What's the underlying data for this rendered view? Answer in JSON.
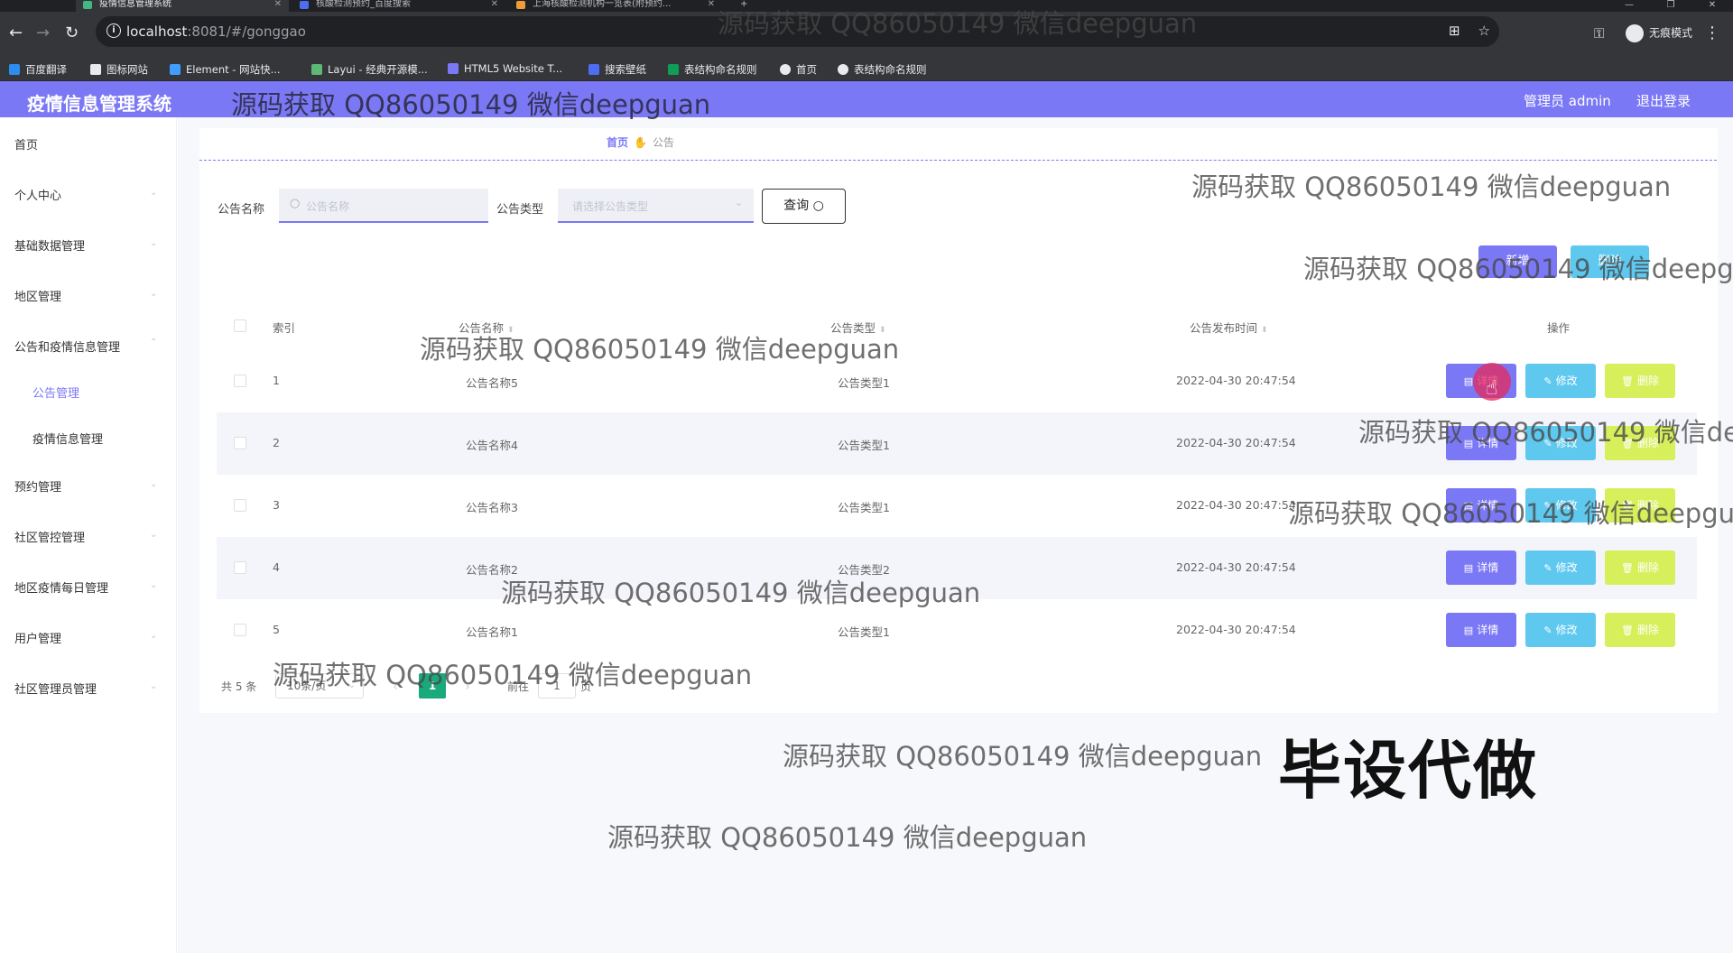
{
  "browser": {
    "tabs": [
      {
        "label": "疫情信息管理系统",
        "active": true
      },
      {
        "label": "核酸检测预约_百度搜索",
        "active": false
      },
      {
        "label": "上海核酸检测机构一览表(附预约...",
        "active": false
      }
    ],
    "new_tab": "+",
    "url_host": "localhost",
    "url_rest": ":8081/#/gonggao",
    "incognito_label": "无痕模式",
    "bookmarks": [
      "百度翻译",
      "图标网站",
      "Element - 网站快...",
      "Layui - 经典开源模...",
      "HTML5 Website T...",
      "搜索壁纸",
      "表结构命名规则",
      "首页",
      "表结构命名规则"
    ]
  },
  "header": {
    "title": "疫情信息管理系统",
    "admin_label": "管理员 admin",
    "logout": "退出登录"
  },
  "sidebar": {
    "items": [
      {
        "label": "首页",
        "arrow": false
      },
      {
        "label": "个人中心",
        "arrow": true
      },
      {
        "label": "基础数据管理",
        "arrow": true
      },
      {
        "label": "地区管理",
        "arrow": true
      },
      {
        "label": "公告和疫情信息管理",
        "arrow": true
      },
      {
        "label": "公告管理",
        "sub": true,
        "active": true
      },
      {
        "label": "疫情信息管理",
        "sub": true
      },
      {
        "label": "预约管理",
        "arrow": true
      },
      {
        "label": "社区管控管理",
        "arrow": true
      },
      {
        "label": "地区疫情每日管理",
        "arrow": true
      },
      {
        "label": "用户管理",
        "arrow": true
      },
      {
        "label": "社区管理员管理",
        "arrow": true
      }
    ]
  },
  "breadcrumb": {
    "home": "首页",
    "current": "公告"
  },
  "search": {
    "name_label": "公告名称",
    "name_placeholder": "公告名称",
    "type_label": "公告类型",
    "type_placeholder": "请选择公告类型",
    "query_button": "查询"
  },
  "toolbar": {
    "add": "新增",
    "batch_delete": "删除"
  },
  "table": {
    "headers": {
      "index": "索引",
      "name": "公告名称",
      "type": "公告类型",
      "time": "公告发布时间",
      "actions": "操作"
    },
    "rows": [
      {
        "index": "1",
        "name": "公告名称5",
        "type": "公告类型1",
        "time": "2022-04-30 20:47:54"
      },
      {
        "index": "2",
        "name": "公告名称4",
        "type": "公告类型1",
        "time": "2022-04-30 20:47:54"
      },
      {
        "index": "3",
        "name": "公告名称3",
        "type": "公告类型1",
        "time": "2022-04-30 20:47:54"
      },
      {
        "index": "4",
        "name": "公告名称2",
        "type": "公告类型2",
        "time": "2022-04-30 20:47:54"
      },
      {
        "index": "5",
        "name": "公告名称1",
        "type": "公告类型1",
        "time": "2022-04-30 20:47:54"
      }
    ],
    "actions": {
      "detail": "详情",
      "edit": "修改",
      "delete": "删除"
    }
  },
  "pagination": {
    "total": "共 5 条",
    "page_size": "10条/页",
    "current_page": "1",
    "goto_label": "前往",
    "goto_value": "1",
    "page_unit": "页"
  },
  "watermark": "源码获取 QQ86050149 微信deepguan",
  "stamp": "毕设代做",
  "colors": {
    "accent": "#7b78f5",
    "edit": "#5fc8ef",
    "delete": "#d6ef5a",
    "page_active": "#1aa97b"
  }
}
